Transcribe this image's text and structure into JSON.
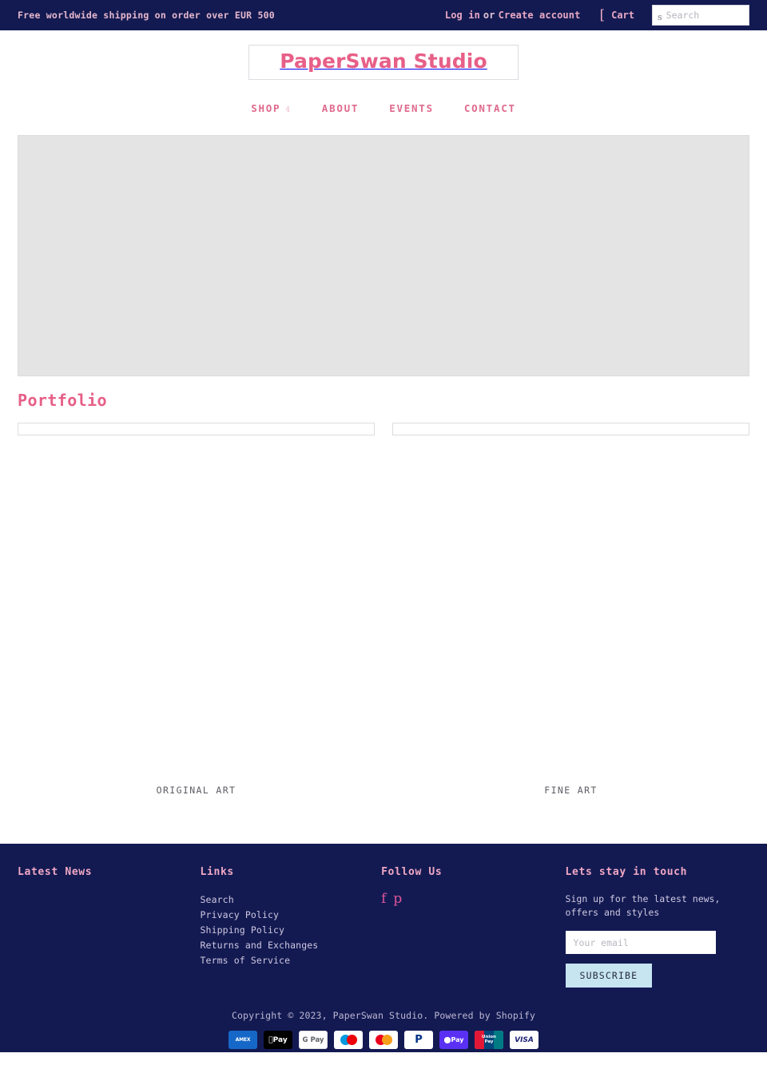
{
  "topbar": {
    "announcement": "Free worldwide shipping on order over EUR 500",
    "login_label": "Log in",
    "or_label": "or",
    "create_account_label": "Create account",
    "cart_icon": "cart-icon-glyph",
    "cart_label": "Cart",
    "search_icon": "search-icon-glyph",
    "search_placeholder": "Search",
    "search_value": ""
  },
  "header": {
    "logo": "PaperSwan Studio",
    "nav": [
      {
        "label": "SHOP",
        "caret": "4"
      },
      {
        "label": "ABOUT",
        "caret": ""
      },
      {
        "label": "EVENTS",
        "caret": ""
      },
      {
        "label": "CONTACT",
        "caret": ""
      }
    ]
  },
  "main": {
    "section_title": "Portfolio",
    "cards": [
      {
        "caption": "ORIGINAL ART"
      },
      {
        "caption": "FINE ART"
      }
    ]
  },
  "footer": {
    "columns": {
      "latest_news": {
        "title": "Latest News"
      },
      "links": {
        "title": "Links",
        "items": [
          "Search",
          "Privacy Policy",
          "Shipping Policy",
          "Returns and Exchanges",
          "Terms of Service"
        ]
      },
      "follow": {
        "title": "Follow Us",
        "socials": [
          {
            "name": "facebook-icon",
            "glyph": "f"
          },
          {
            "name": "pinterest-icon",
            "glyph": "p"
          }
        ]
      },
      "newsletter": {
        "title": "Lets stay in touch",
        "text": "Sign up for the latest news, offers and styles",
        "email_placeholder": "Your email",
        "email_value": "",
        "subscribe_label": "SUBSCRIBE"
      }
    },
    "copyright": "Copyright © 2023, PaperSwan Studio. Powered by Shopify",
    "payments": [
      {
        "name": "amex-icon",
        "label": "AMEX"
      },
      {
        "name": "apple-pay-icon",
        "label": "Pay"
      },
      {
        "name": "google-pay-icon",
        "label": "Pay"
      },
      {
        "name": "maestro-icon",
        "label": ""
      },
      {
        "name": "mastercard-icon",
        "label": ""
      },
      {
        "name": "paypal-icon",
        "label": ""
      },
      {
        "name": "shop-pay-icon",
        "label": "Pay"
      },
      {
        "name": "unionpay-icon",
        "label": "UnionPay"
      },
      {
        "name": "visa-icon",
        "label": "VISA"
      }
    ]
  },
  "colors": {
    "navy": "#131a52",
    "pink": "#e75f87",
    "light_blue": "#c7e4f1",
    "placeholder_gray": "#e4e4e4"
  }
}
